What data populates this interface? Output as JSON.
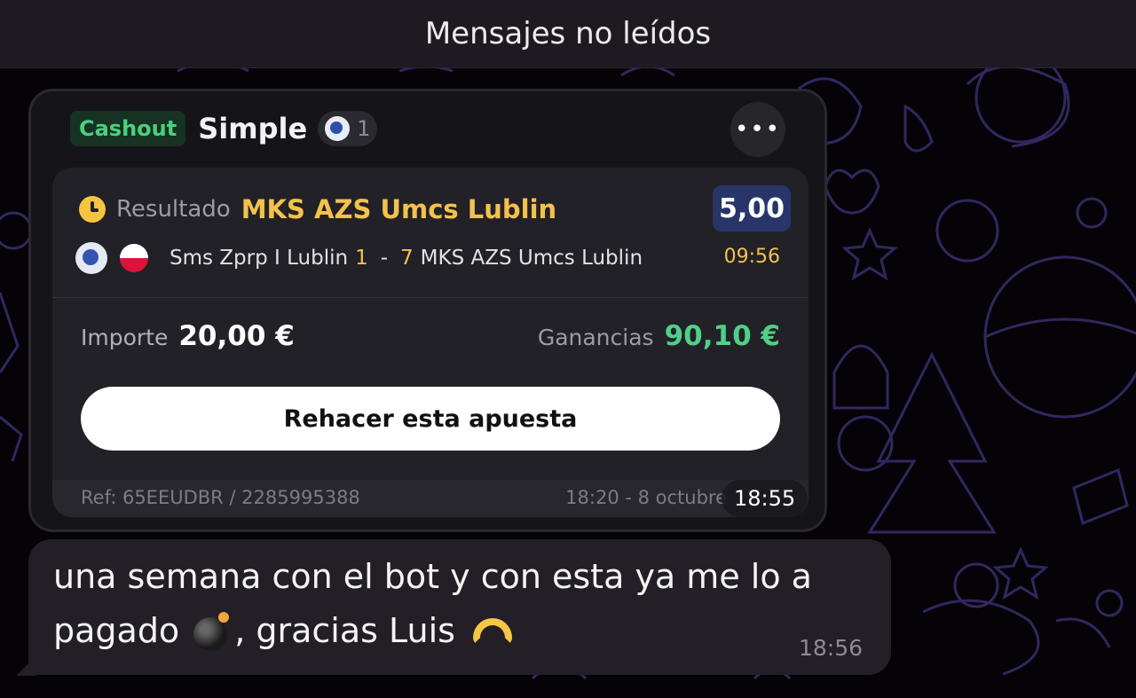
{
  "header": {
    "unread_label": "Mensajes no leídos"
  },
  "bet_card": {
    "badge": "Cashout",
    "type": "Simple",
    "selection_count": "1",
    "result_label": "Resultado",
    "result_team": "MKS AZS Umcs Lublin",
    "odds": "5,00",
    "match": {
      "home": "Sms Zprp I Lublin",
      "home_score": "1",
      "separator": "-",
      "away_score": "7",
      "away": "MKS AZS Umcs Lublin",
      "time": "09:56"
    },
    "stake_label": "Importe",
    "stake_value": "20,00 €",
    "win_label": "Ganancias",
    "win_value": "90,10 €",
    "redo_button": "Rehacer esta apuesta",
    "ref": "Ref: 65EEUDBR / 2285995388",
    "placed": "18:20 - 8 octubre",
    "message_time": "18:55"
  },
  "message": {
    "line1": "una semana con el bot y con esta ya me lo a",
    "line2_start": "pagado",
    "line2_end": ", gracias Luis",
    "time": "18:56"
  },
  "colors": {
    "accent_yellow": "#f3c24d",
    "win_green": "#4fd087",
    "cashout_green": "#4bd07f",
    "odds_blue": "#283568",
    "pattern": "#3a2a6a"
  }
}
